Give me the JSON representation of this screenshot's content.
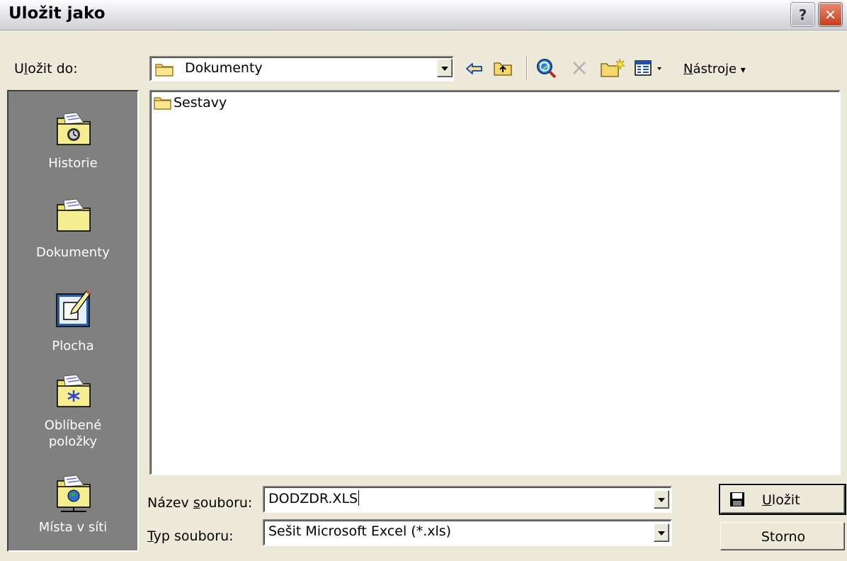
{
  "window": {
    "title": "Uložit jako"
  },
  "titlebar": {
    "help_glyph": "?",
    "close_glyph": "✕"
  },
  "look_in": {
    "label_pre": "U",
    "label_ul": "l",
    "label_post": "ožit do:",
    "value": "Dokumenty"
  },
  "toolbar": {
    "icons": [
      "back-arrow-icon",
      "up-folder-icon",
      "search-web-icon",
      "delete-icon",
      "new-folder-icon",
      "views-icon"
    ],
    "tools_ul": "N",
    "tools_rest": "ástroje",
    "dropdown_glyph": "▾"
  },
  "places": [
    {
      "label": "Historie",
      "icon": "history-icon"
    },
    {
      "label": "Dokumenty",
      "icon": "documents-icon"
    },
    {
      "label": "Plocha",
      "icon": "desktop-icon"
    },
    {
      "label": "Oblíbené položky",
      "icon": "favorites-icon"
    },
    {
      "label": "Místa v síti",
      "icon": "network-places-icon"
    }
  ],
  "files": [
    {
      "name": "Sestavy",
      "icon": "folder-icon"
    }
  ],
  "filename": {
    "label_pre": "Název ",
    "label_ul": "s",
    "label_post": "ouboru:",
    "value": "DODZDR.XLS"
  },
  "filetype": {
    "label_ul": "T",
    "label_post": "yp souboru:",
    "value": "Sešit Microsoft Excel (*.xls)"
  },
  "buttons": {
    "save_ul": "U",
    "save_rest": "ložit",
    "cancel": "Storno"
  },
  "colors": {
    "places_bg": "#808080",
    "dialog_bg": "#ece9d8",
    "close_button": "#c63e1e"
  }
}
